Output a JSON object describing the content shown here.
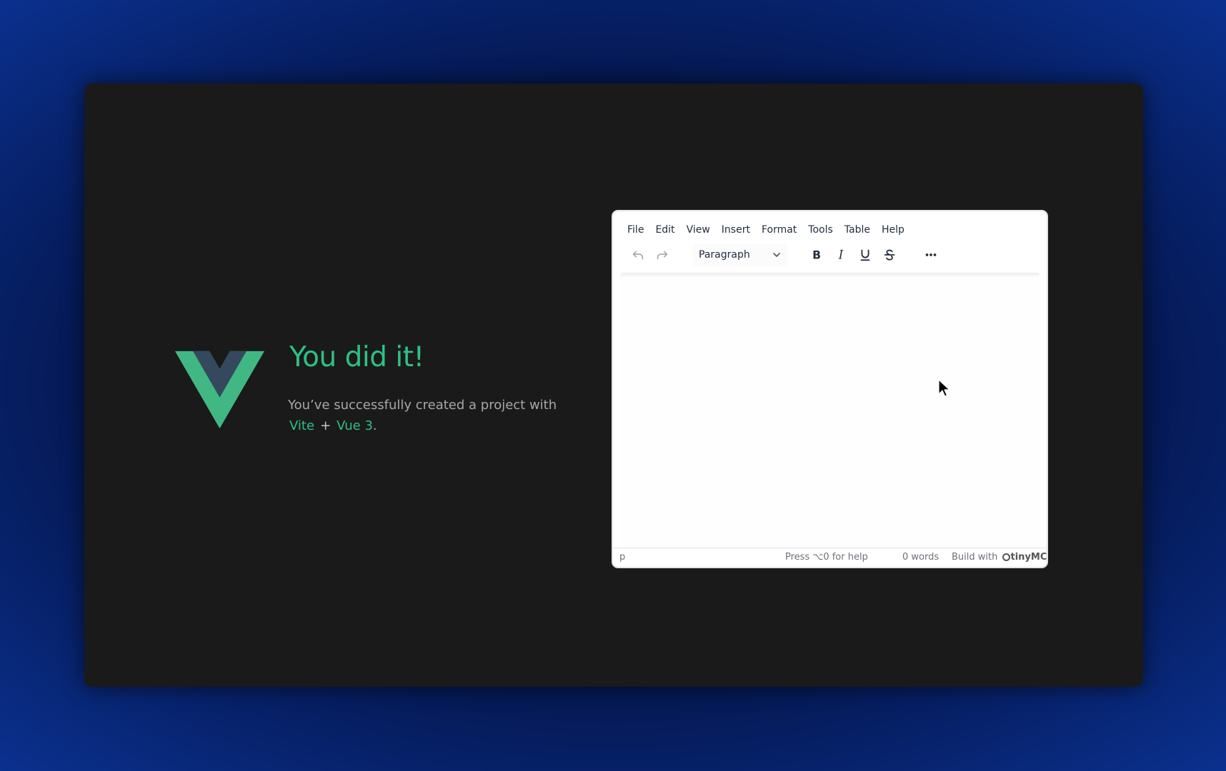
{
  "hello": {
    "title": "You did it!",
    "subtitle_prefix": "You’ve successfully created a project with",
    "link_vite": "Vite",
    "plus": "+",
    "link_vue": "Vue 3",
    "period": "."
  },
  "editor": {
    "menu": [
      "File",
      "Edit",
      "View",
      "Insert",
      "Format",
      "Tools",
      "Table",
      "Help"
    ],
    "toolbar": {
      "undo_icon": "undo-icon",
      "redo_icon": "redo-icon",
      "block_format": "Paragraph",
      "bold_icon": "bold-icon",
      "italic_icon": "italic-icon",
      "underline_icon": "underline-icon",
      "strikethrough_icon": "strikethrough-icon",
      "more_icon": "more-icon"
    },
    "statusbar": {
      "path": "p",
      "help": "Press ⌥0 for help",
      "words": "0 words",
      "brand_prefix": "Build with",
      "brand_name": "tinyMCE"
    }
  },
  "colors": {
    "vue_green": "#2fbf85",
    "vue_dark": "#35495e",
    "window_bg": "#1a1a1a"
  }
}
